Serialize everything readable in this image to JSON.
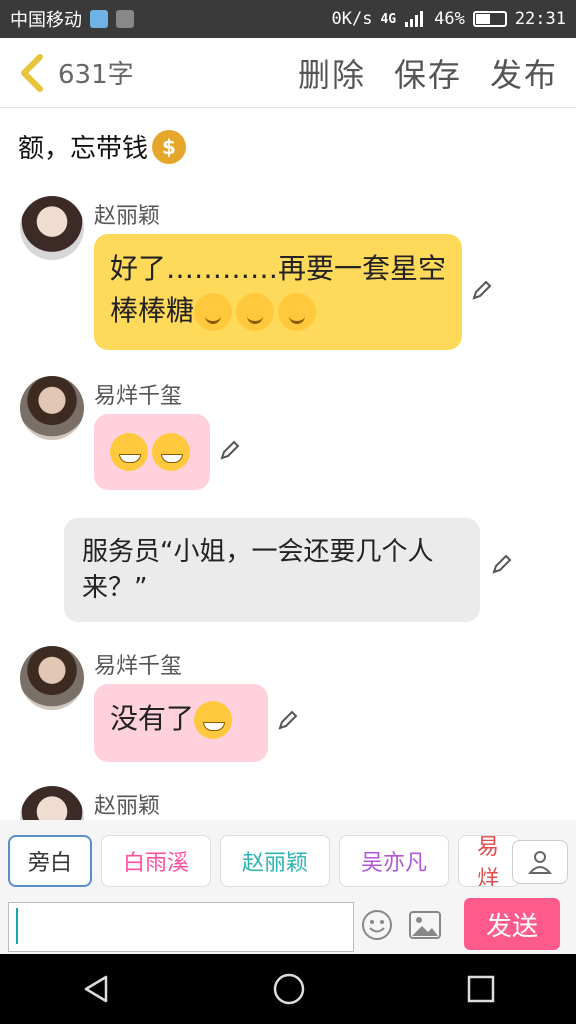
{
  "status_bar": {
    "carrier": "中国移动",
    "network_speed": "0K/s",
    "network_type_1": "4G",
    "network_type_2": "4G",
    "battery": "46%",
    "battery_level": 0.46,
    "time": "22:31"
  },
  "header": {
    "char_count": "631字",
    "actions": {
      "delete": "删除",
      "save": "保存",
      "publish": "发布"
    }
  },
  "story": {
    "top_narration": "额，忘带钱",
    "messages": [
      {
        "speaker": "赵丽颖",
        "text": "好了…………再要一套星空棒棒糖",
        "bubble": "yellow"
      },
      {
        "speaker": "易烊千玺",
        "text": "",
        "bubble": "pink"
      },
      {
        "speaker": "",
        "text": "服务员“小姐，一会还要几个人来？”",
        "bubble": "gray"
      },
      {
        "speaker": "易烊千玺",
        "text": "没有了",
        "bubble": "pink"
      },
      {
        "speaker": "赵丽颖",
        "text": "",
        "bubble": "yellow"
      }
    ]
  },
  "characters": [
    "旁白",
    "白雨溪",
    "赵丽颖",
    "吴亦凡",
    "易烊"
  ],
  "input": {
    "value": "",
    "placeholder": ""
  },
  "send_label": "发送",
  "colors": {
    "send": "#ff5a8c",
    "bubble_yellow": "#ffd95a",
    "bubble_pink": "#ffd1dc",
    "bubble_gray": "#ebebeb",
    "active_tab_border": "#5b8fc9"
  }
}
